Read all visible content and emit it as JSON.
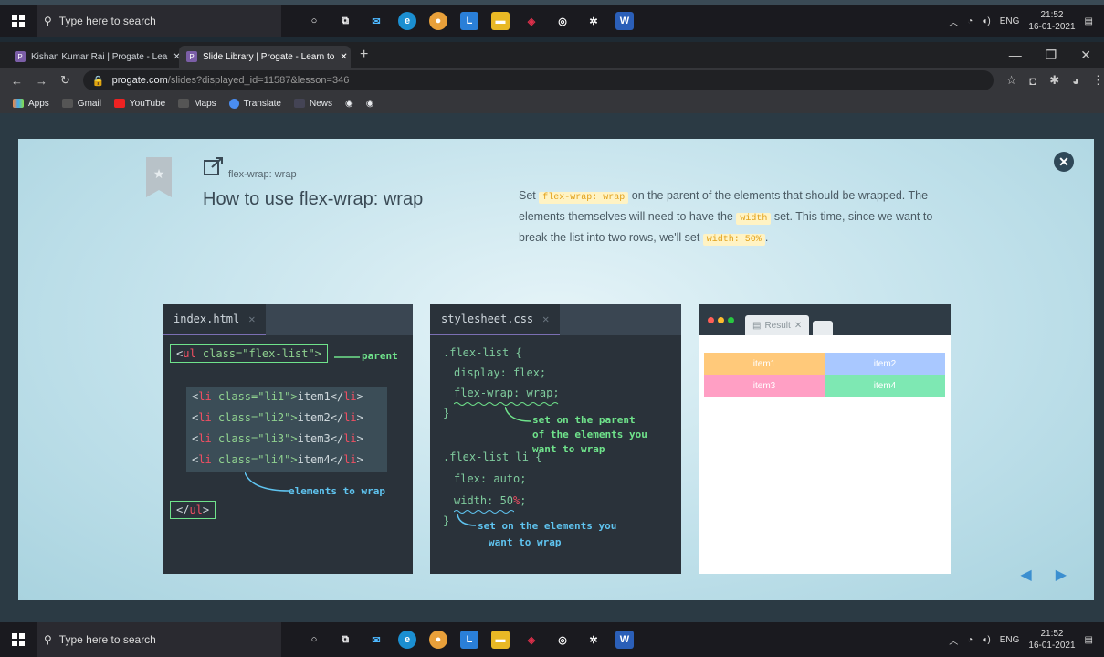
{
  "taskbar": {
    "search_placeholder": "Type here to search",
    "lang": "ENG",
    "time": "21:52",
    "date": "16-01-2021"
  },
  "browser": {
    "tabs": [
      {
        "label": "Kishan Kumar Rai | Progate - Lea",
        "favicon": "P"
      },
      {
        "label": "Slide Library | Progate - Learn to",
        "favicon": "P"
      }
    ],
    "url_host": "progate.com",
    "url_path": "/slides?displayed_id=11587&lesson=346",
    "bookmarks": [
      "Apps",
      "Gmail",
      "YouTube",
      "Maps",
      "Translate",
      "News"
    ]
  },
  "slide": {
    "subtitle": "flex-wrap: wrap",
    "title": "How to use flex-wrap: wrap",
    "desc": {
      "p1": "Set",
      "code1": "flex-wrap: wrap",
      "p2": "on the parent of the elements that should be wrapped. The elements themselves will need to have the",
      "code2": "width",
      "p3": "set. This time, since we want to break the list into two rows, we'll set",
      "code3": "width: 50%",
      "p4": "."
    },
    "html_panel": {
      "tab": "index.html",
      "ul_open_pre": "<",
      "ul_open_tag": "ul",
      "ul_open_post": " class=\"flex-list\">",
      "parent_note": "parent",
      "items": [
        {
          "pre": "<",
          "tag": "li",
          "attr": " class=\"li1\">",
          "text": "item1",
          "close_pre": "</",
          "close_tag": "li",
          "close_post": ">"
        },
        {
          "pre": "<",
          "tag": "li",
          "attr": " class=\"li2\">",
          "text": "item2",
          "close_pre": "</",
          "close_tag": "li",
          "close_post": ">"
        },
        {
          "pre": "<",
          "tag": "li",
          "attr": " class=\"li3\">",
          "text": "item3",
          "close_pre": "</",
          "close_tag": "li",
          "close_post": ">"
        },
        {
          "pre": "<",
          "tag": "li",
          "attr": " class=\"li4\">",
          "text": "item4",
          "close_pre": "</",
          "close_tag": "li",
          "close_post": ">"
        }
      ],
      "ul_close_pre": "</",
      "ul_close_tag": "ul",
      "ul_close_post": ">",
      "wrap_note": "elements to wrap"
    },
    "css_panel": {
      "tab": "stylesheet.css",
      "sel1": ".flex-list {",
      "l1": "display: flex;",
      "l2": "flex-wrap: wrap;",
      "close1": "}",
      "note1a": "set on the parent",
      "note1b": "of the elements you",
      "note1c": "want to wrap",
      "sel2": ".flex-list li {",
      "l3": "flex: auto;",
      "l4_pre": "width: 50",
      "l4_pct": "%",
      "l4_post": ";",
      "close2": "}",
      "note2a": "set on the elements you",
      "note2b": "want to wrap"
    },
    "result": {
      "tab": "Result",
      "items": [
        "item1",
        "item2",
        "item3",
        "item4"
      ]
    }
  },
  "colors": {
    "item1": "#ffc97a",
    "item2": "#a9c8ff",
    "item3": "#ff9fc4",
    "item4": "#7ee8b3"
  }
}
